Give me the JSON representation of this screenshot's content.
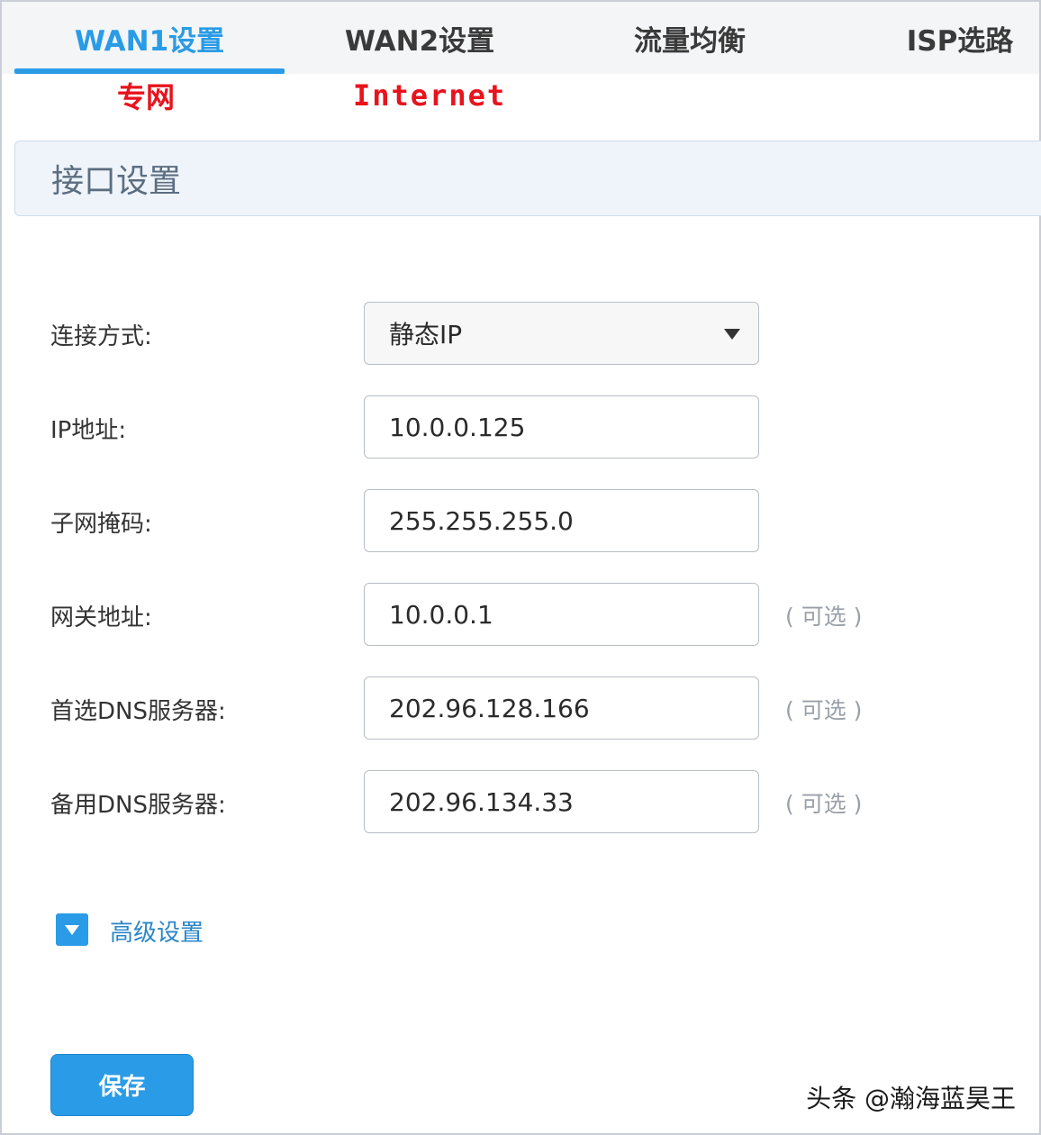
{
  "tabs": [
    {
      "label": "WAN1设置",
      "active": true
    },
    {
      "label": "WAN2设置",
      "active": false
    },
    {
      "label": "流量均衡",
      "active": false
    },
    {
      "label": "ISP选路",
      "active": false
    }
  ],
  "annotations": {
    "wan1": "专网",
    "wan2": "Internet"
  },
  "section": {
    "title": "接口设置"
  },
  "form": {
    "connection": {
      "label": "连接方式:",
      "value": "静态IP"
    },
    "ip": {
      "label": "IP地址:",
      "value": "10.0.0.125"
    },
    "mask": {
      "label": "子网掩码:",
      "value": "255.255.255.0"
    },
    "gateway": {
      "label": "网关地址:",
      "value": "10.0.0.1",
      "hint": "( 可选 )"
    },
    "dns1": {
      "label": "首选DNS服务器:",
      "value": "202.96.128.166",
      "hint": "( 可选 )"
    },
    "dns2": {
      "label": "备用DNS服务器:",
      "value": "202.96.134.33",
      "hint": "( 可选 )"
    }
  },
  "advanced": {
    "label": "高级设置"
  },
  "save": {
    "label": "保存"
  },
  "watermark": "头条 @瀚海蓝昊王",
  "colors": {
    "accent": "#2a9be6",
    "annotation": "#e8131d",
    "section_bg": "#eef4fa"
  }
}
